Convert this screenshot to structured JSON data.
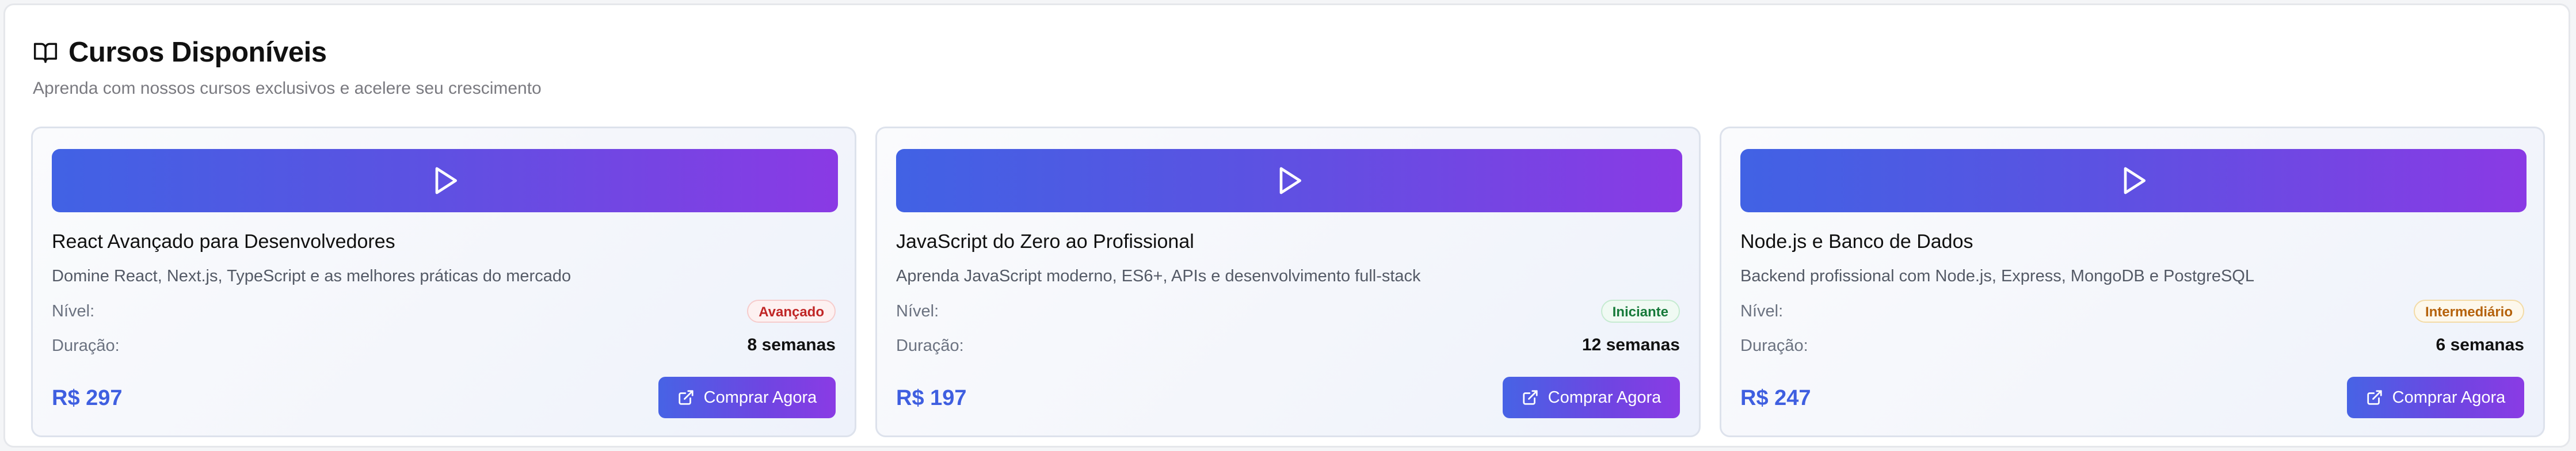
{
  "header": {
    "icon": "book-open-icon",
    "title": "Cursos Disponíveis",
    "subtitle": "Aprenda com nossos cursos exclusivos e acelere seu crescimento"
  },
  "labels": {
    "level": "Nível:",
    "duration": "Duração:",
    "buy_button": "Comprar Agora"
  },
  "colors": {
    "accent": "#3f5fe0",
    "gradient_start": "#4162e4",
    "gradient_end": "#8a3ae4"
  },
  "courses": [
    {
      "name": "React Avançado para Desenvolvedores",
      "description": "Domine React, Next.js, TypeScript e as melhores práticas do mercado",
      "level": "Avançado",
      "level_color": "#c02626",
      "duration": "8 semanas",
      "price": "R$ 297",
      "thumbnail_icon": "play-icon"
    },
    {
      "name": "JavaScript do Zero ao Profissional",
      "description": "Aprenda JavaScript moderno, ES6+, APIs e desenvolvimento full-stack",
      "level": "Iniciante",
      "level_color": "#167a3a",
      "duration": "12 semanas",
      "price": "R$ 197",
      "thumbnail_icon": "play-icon"
    },
    {
      "name": "Node.js e Banco de Dados",
      "description": "Backend profissional com Node.js, Express, MongoDB e PostgreSQL",
      "level": "Intermediário",
      "level_color": "#b5620b",
      "duration": "6 semanas",
      "price": "R$ 247",
      "thumbnail_icon": "play-icon"
    }
  ]
}
